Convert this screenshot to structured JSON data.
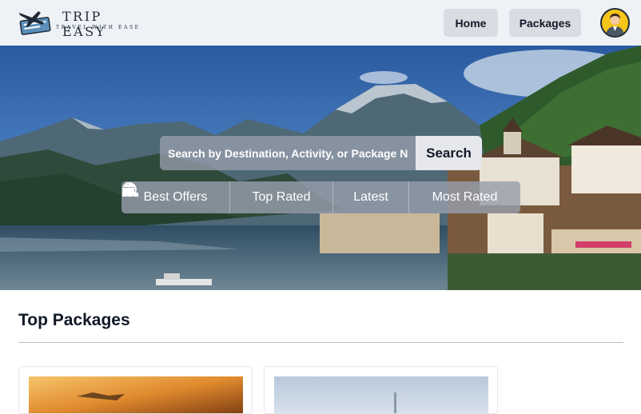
{
  "header": {
    "logo_title": "TRIP EASY",
    "logo_subtitle": "TRAVEL WITH EASE",
    "nav": {
      "home": "Home",
      "packages": "Packages"
    },
    "avatar_icon": "user-avatar-icon"
  },
  "hero": {
    "search": {
      "placeholder": "Search by Destination, Activity, or Package Na",
      "button_label": "Search"
    },
    "filters": [
      {
        "label": "Best Offers",
        "icon": "discount-badge-icon"
      },
      {
        "label": "Top Rated",
        "icon": "star-icon"
      },
      {
        "label": "Latest",
        "icon": "calendar-icon"
      },
      {
        "label": "Most Rated",
        "icon": "podium-icon"
      }
    ]
  },
  "main": {
    "section_title": "Top Packages"
  },
  "colors": {
    "header_bg": "#eef2f7",
    "button_bg": "#d9dde3",
    "avatar_bg": "#f5c518"
  }
}
